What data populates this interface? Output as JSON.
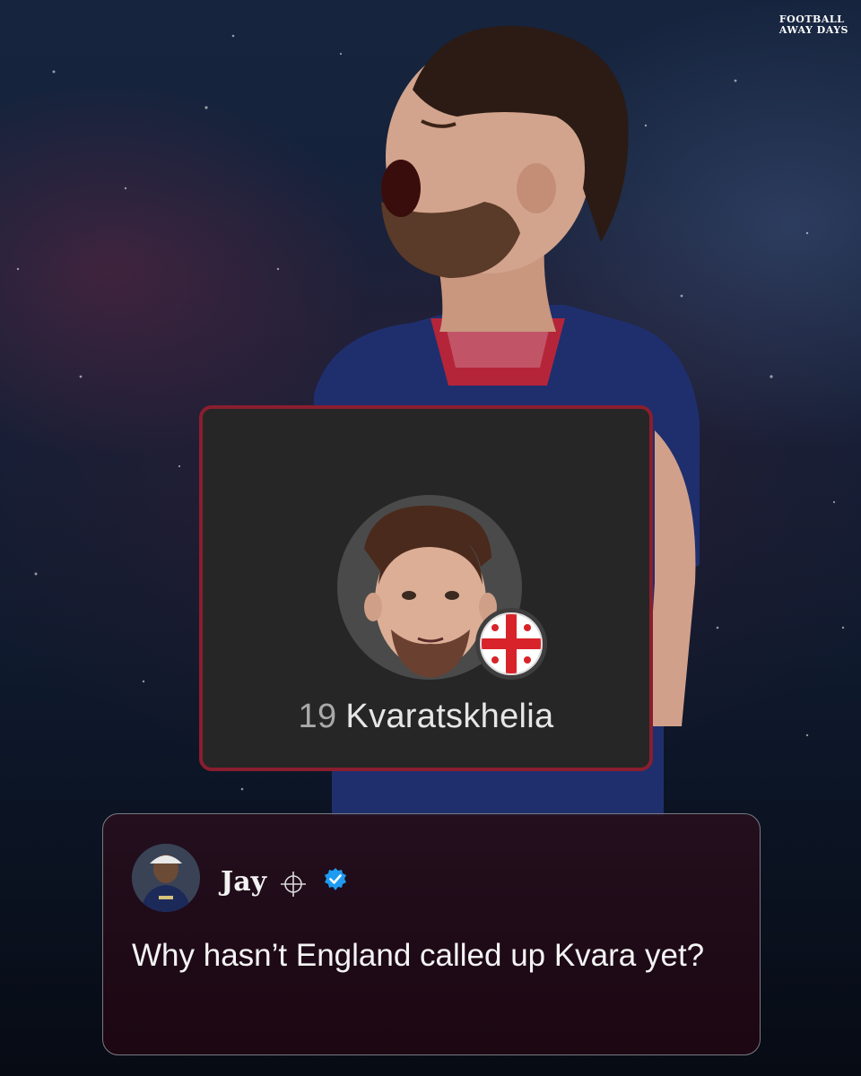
{
  "brand": {
    "line1": "FOOTBALL",
    "line2": "AWAY DAYS"
  },
  "player_card": {
    "number": "19",
    "name": "Kvaratskhelia",
    "flag_icon": "england-flag-icon"
  },
  "tweet": {
    "author": "Jay",
    "author_icon": "crosshair-icon",
    "verified_icon": "verified-badge-icon",
    "text": "Why hasn’t England called up Kvara yet?"
  },
  "colors": {
    "card_border": "#8a1e2e",
    "card_background": "#262626",
    "verified_blue": "#1d9bf0",
    "flag_red": "#d8232a"
  }
}
